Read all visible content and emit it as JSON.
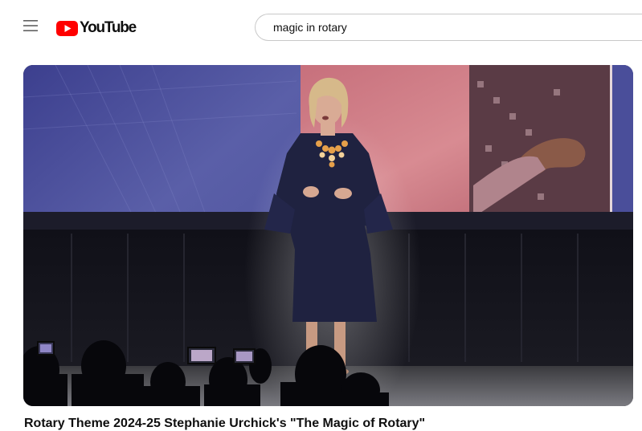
{
  "header": {
    "menu_icon": "hamburger-menu-icon",
    "logo_icon": "youtube-play-icon",
    "logo_text": "YouTube",
    "brand_color": "#ff0000",
    "search": {
      "value": "magic in rotary"
    }
  },
  "video": {
    "title": "Rotary Theme 2024-25 Stephanie Urchick's \"The Magic of Rotary\""
  }
}
